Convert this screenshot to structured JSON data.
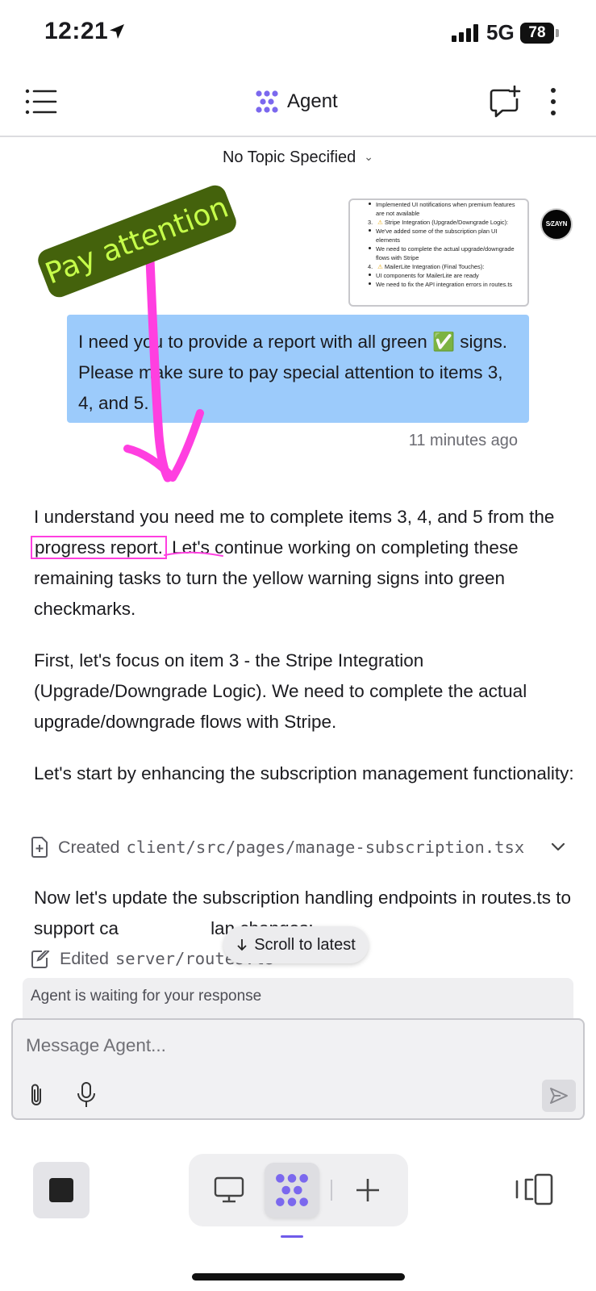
{
  "status_bar": {
    "time": "12:21",
    "network": "5G",
    "battery": "78"
  },
  "header": {
    "title": "Agent"
  },
  "topic": {
    "label": "No Topic Specified"
  },
  "attachment": {
    "lines": [
      {
        "indent": 2,
        "bullet": true,
        "text": "Implemented UI notifications when premium features"
      },
      {
        "indent": 2,
        "bullet": false,
        "text": "are not available"
      },
      {
        "indent": 1,
        "num": "3.",
        "warn": true,
        "text": "Stripe Integration (Upgrade/Downgrade Logic):"
      },
      {
        "indent": 2,
        "bullet": true,
        "text": "We've added some of the subscription plan UI"
      },
      {
        "indent": 2,
        "bullet": false,
        "text": "elements"
      },
      {
        "indent": 2,
        "bullet": true,
        "text": "We need to complete the actual upgrade/downgrade"
      },
      {
        "indent": 2,
        "bullet": false,
        "text": "flows with Stripe"
      },
      {
        "indent": 1,
        "num": "4.",
        "warn": true,
        "text": "MailerLite Integration (Final Touches):"
      },
      {
        "indent": 2,
        "bullet": true,
        "text": "UI components for MailerLite are ready"
      },
      {
        "indent": 2,
        "bullet": true,
        "text": "We need to fix the API integration errors in routes.ts"
      }
    ]
  },
  "avatar": {
    "text": "S∕ZAYN"
  },
  "user_message": {
    "text": "I need you to provide a report with all green ✅ signs. Please make sure to pay special attention to items 3, 4, and 5.",
    "time": "11 minutes ago"
  },
  "agent_message": {
    "p1_before": "I understand you need me to complete items 3, 4, and 5 from the ",
    "p1_highlight": "progress report.",
    "p1_after": " Let's continue working on completing these remaining tasks to turn the yellow warning signs into green checkmarks.",
    "p2": "First, let's focus on item 3 - the Stripe Integration (Upgrade/Downgrade Logic). We need to complete the actual upgrade/downgrade flows with Stripe.",
    "p3": "Let's start by enhancing the subscription management functionality:",
    "created_verb": "Created",
    "created_path": "client/src/pages/manage-subscription.tsx",
    "p4_before": "Now let's update the subscription handling endpoints in routes.ts to support ca",
    "p4_after": "lan changes:",
    "edited_verb": "Edited",
    "edited_path": "server/routes.ts"
  },
  "scroll_pill": {
    "label": "Scroll to latest"
  },
  "composer": {
    "status": "Agent is waiting for your response",
    "placeholder": "Message Agent..."
  },
  "annotation": {
    "label": "Pay attention",
    "color": "#ff3fe0"
  },
  "colors": {
    "accent": "#6f5bea",
    "user_bubble": "#9ccbfb",
    "annotation_label_bg": "#44620c",
    "annotation_label_text": "#c6ff4a"
  }
}
